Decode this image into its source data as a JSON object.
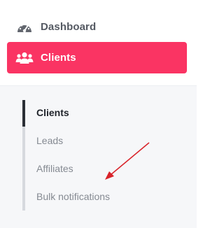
{
  "nav": {
    "dashboard": {
      "label": "Dashboard",
      "icon": "gauge-icon"
    },
    "clients": {
      "label": "Clients",
      "icon": "users-icon"
    }
  },
  "submenu": {
    "items": [
      {
        "label": "Clients",
        "active": true
      },
      {
        "label": "Leads",
        "active": false
      },
      {
        "label": "Affiliates",
        "active": false
      },
      {
        "label": "Bulk notifications",
        "active": false
      }
    ]
  },
  "colors": {
    "accent": "#fa3463",
    "annotation_arrow": "#d9232a"
  }
}
